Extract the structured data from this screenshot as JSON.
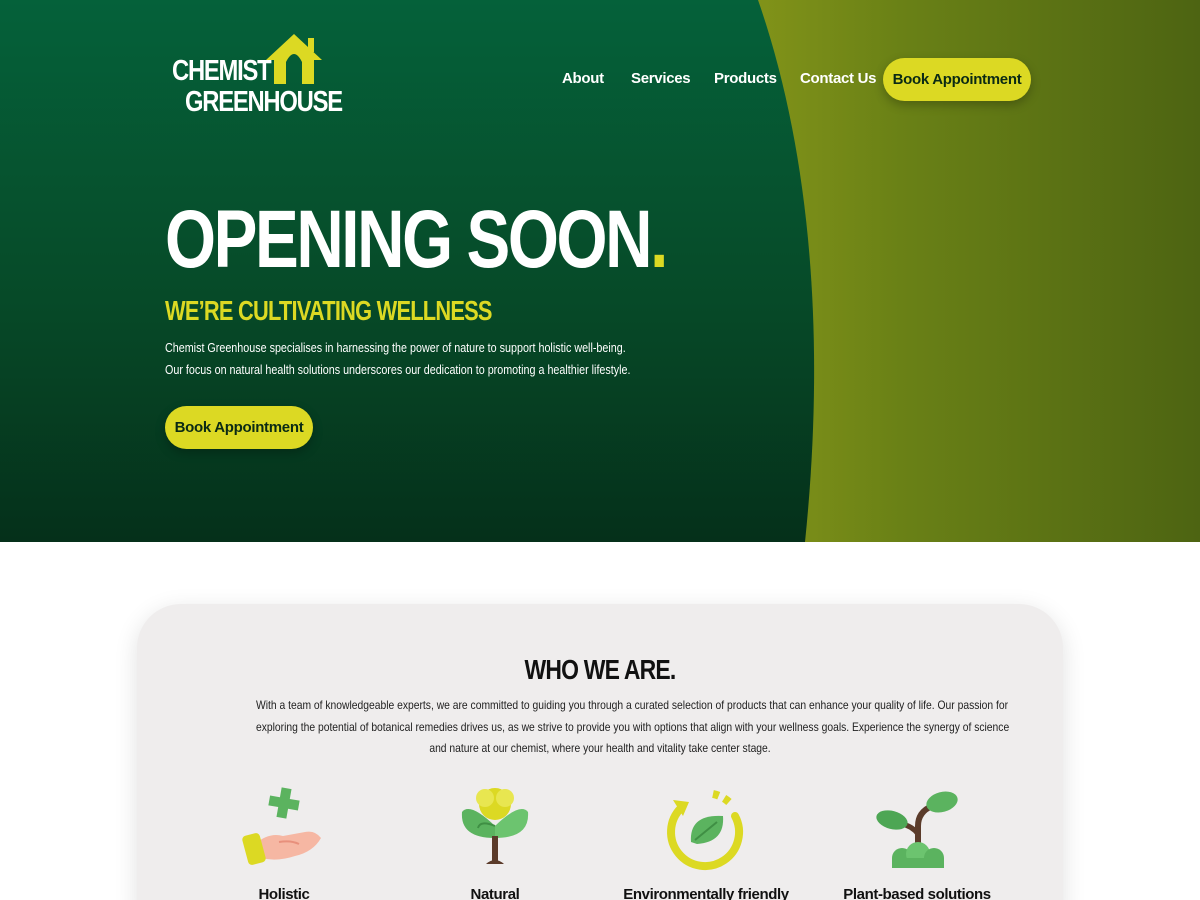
{
  "brand": {
    "line1": "CHEMIST",
    "line2": "GREENHOUSE"
  },
  "nav": {
    "about": "About",
    "services": "Services",
    "products": "Products",
    "contact": "Contact Us",
    "cta": "Book Appointment"
  },
  "hero": {
    "title": "OPENING SOON",
    "title_dot": ".",
    "subtitle": "WE’RE CULTIVATING WELLNESS",
    "text_lines": [
      "Chemist Greenhouse specialises in harnessing the power of nature to support holistic well-being.",
      "Our focus on natural health solutions underscores our dedication to promoting a healthier lifestyle."
    ],
    "cta": "Book Appointment"
  },
  "who": {
    "title": "WHO WE ARE.",
    "text_lines": [
      "With a team of knowledgeable experts, we are committed to guiding you through a curated selection of products that can enhance your quality of life. Our passion for",
      "exploring the potential of botanical remedies drives us, as we strive to provide you with options that align with your wellness goals. Experience the synergy of science",
      "and nature at our chemist, where your health and vitality take center stage."
    ],
    "features": [
      {
        "label": "Holistic",
        "icon": "hand-cross-icon"
      },
      {
        "label": "Natural",
        "icon": "flower-plant-icon"
      },
      {
        "label": "Environmentally friendly",
        "icon": "recycle-leaf-icon"
      },
      {
        "label": "Plant-based solutions",
        "icon": "sprout-icon"
      }
    ]
  },
  "colors": {
    "dark_green": "#0a4a24",
    "accent_yellow": "#dcd923",
    "card_bg": "#efeded"
  }
}
